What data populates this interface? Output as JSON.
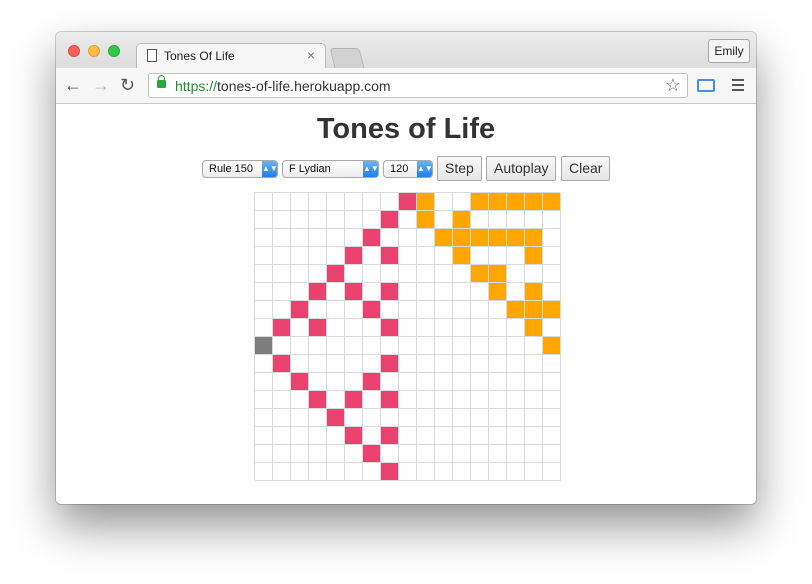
{
  "browser": {
    "tab_title": "Tones Of Life",
    "tab_close": "×",
    "profile_name": "Emily",
    "url_scheme": "https://",
    "url_host": "tones-of-life.herokuapp.com",
    "icons": [
      "back-arrow-icon",
      "forward-arrow-icon",
      "reload-icon",
      "lock-icon",
      "star-icon",
      "cast-icon",
      "menu-icon",
      "document-icon"
    ]
  },
  "page": {
    "title": "Tones of Life",
    "rule_select": "Rule 150",
    "scale_select": "F Lydian",
    "tempo_select": "120",
    "step_label": "Step",
    "autoplay_label": "Autoplay",
    "clear_label": "Clear"
  },
  "board": {
    "cols": 17,
    "rows": 16,
    "colors": {
      "pink": "#e9426f",
      "orange": "#ffa600",
      "gray": "#7d7d7d",
      "grid": "#dadada"
    },
    "pink": [
      [
        8,
        0
      ],
      [
        7,
        1
      ],
      [
        6,
        2
      ],
      [
        5,
        3
      ],
      [
        7,
        3
      ],
      [
        4,
        4
      ],
      [
        3,
        5
      ],
      [
        5,
        5
      ],
      [
        7,
        5
      ],
      [
        2,
        6
      ],
      [
        6,
        6
      ],
      [
        1,
        7
      ],
      [
        3,
        7
      ],
      [
        7,
        7
      ],
      [
        1,
        9
      ],
      [
        7,
        9
      ],
      [
        2,
        10
      ],
      [
        6,
        10
      ],
      [
        3,
        11
      ],
      [
        5,
        11
      ],
      [
        7,
        11
      ],
      [
        4,
        12
      ],
      [
        5,
        13
      ],
      [
        7,
        13
      ],
      [
        6,
        14
      ],
      [
        7,
        15
      ]
    ],
    "orange": [
      [
        9,
        0
      ],
      [
        12,
        0
      ],
      [
        13,
        0
      ],
      [
        14,
        0
      ],
      [
        15,
        0
      ],
      [
        16,
        0
      ],
      [
        9,
        1
      ],
      [
        11,
        1
      ],
      [
        10,
        2
      ],
      [
        11,
        2
      ],
      [
        12,
        2
      ],
      [
        13,
        2
      ],
      [
        14,
        2
      ],
      [
        15,
        2
      ],
      [
        11,
        3
      ],
      [
        15,
        3
      ],
      [
        12,
        4
      ],
      [
        13,
        4
      ],
      [
        13,
        5
      ],
      [
        15,
        5
      ],
      [
        14,
        6
      ],
      [
        15,
        6
      ],
      [
        16,
        6
      ],
      [
        15,
        7
      ],
      [
        16,
        8
      ]
    ],
    "gray": [
      [
        0,
        8
      ]
    ]
  }
}
